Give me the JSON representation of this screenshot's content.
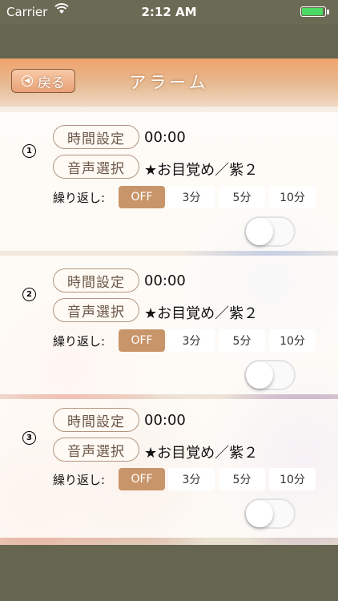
{
  "status_bar": {
    "carrier": "Carrier",
    "time": "2:12 AM",
    "battery_level": 1.0
  },
  "nav": {
    "back_label": "戻る",
    "title": "アラーム"
  },
  "labels": {
    "time_setting": "時間設定",
    "sound_select": "音声選択",
    "repeat": "繰り返し:"
  },
  "repeat_options": [
    "OFF",
    "3分",
    "5分",
    "10分"
  ],
  "alarms": [
    {
      "number": "1",
      "time": "00:00",
      "sound": "★お目覚め／紫２",
      "repeat_selected": "OFF",
      "enabled": false
    },
    {
      "number": "2",
      "time": "00:00",
      "sound": "★お目覚め／紫２",
      "repeat_selected": "OFF",
      "enabled": false
    },
    {
      "number": "3",
      "time": "00:00",
      "sound": "★お目覚め／紫２",
      "repeat_selected": "OFF",
      "enabled": false
    }
  ],
  "colors": {
    "nav_gradient_top": "#f1a36c",
    "selected_segment": "#c8956a",
    "frame": "#66654f"
  }
}
